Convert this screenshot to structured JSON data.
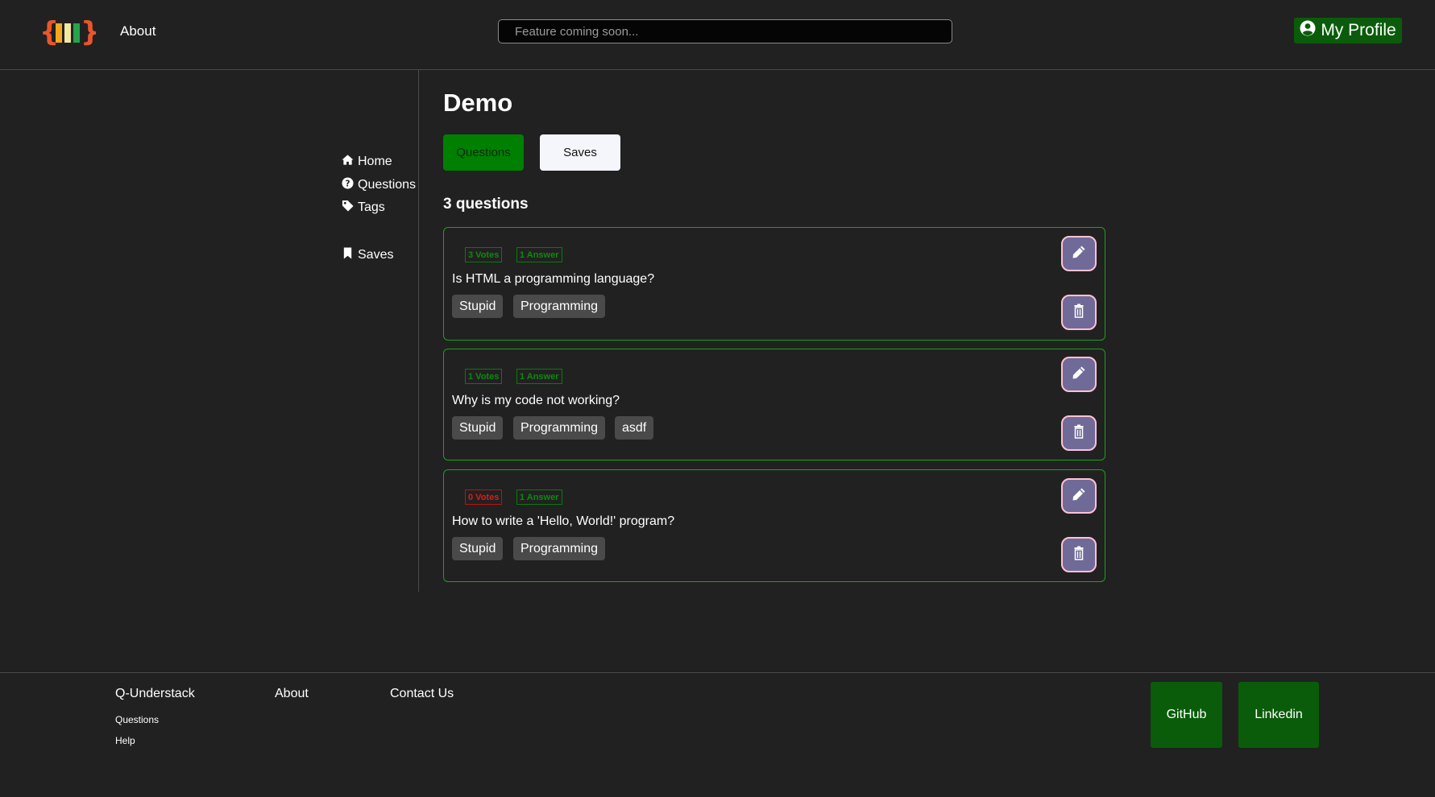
{
  "header": {
    "about_label": "About",
    "search_placeholder": "Feature coming soon...",
    "profile_label": "My Profile",
    "profile_icon": "user-circle-icon",
    "logo_colors": [
      "#e8562a",
      "#f2a81d",
      "#f2e8a0",
      "#27a34a"
    ]
  },
  "sidebar": {
    "items": [
      {
        "label": "Home",
        "icon": "home-icon"
      },
      {
        "label": "Questions",
        "icon": "question-circle-icon"
      },
      {
        "label": "Tags",
        "icon": "tag-icon"
      },
      {
        "label": "Saves",
        "icon": "bookmark-icon"
      }
    ]
  },
  "main": {
    "title": "Demo",
    "tabs": [
      {
        "label": "Questions",
        "active": true
      },
      {
        "label": "Saves",
        "active": false
      }
    ],
    "count_label": "3 questions",
    "questions": [
      {
        "votes": "3 Votes",
        "answers": "1 Answer",
        "title": "Is HTML a programming language?",
        "tags": [
          "Stupid",
          "Programming"
        ]
      },
      {
        "votes": "1 Votes",
        "answers": "1 Answer",
        "title": "Why is my code not working?",
        "tags": [
          "Stupid",
          "Programming",
          "asdf"
        ]
      },
      {
        "votes": "0 Votes",
        "answers": "1 Answer",
        "title": "How to write a 'Hello, World!' program?",
        "tags": [
          "Stupid",
          "Programming"
        ]
      }
    ]
  },
  "footer": {
    "brand": "Q-Understack",
    "links": [
      "Questions",
      "Help"
    ],
    "about": "About",
    "contact": "Contact Us",
    "github": "GitHub",
    "linkedin": "Linkedin"
  },
  "colors": {
    "accent_green": "#008000",
    "card_border": "#18a418",
    "vote_positive": "#0d8a0d",
    "vote_zero": "#e01a1a",
    "action_button": "#6f6a97",
    "action_border": "#ffc2d4"
  }
}
